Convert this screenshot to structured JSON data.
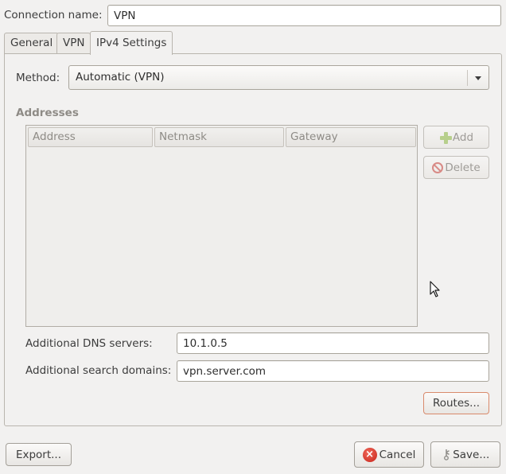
{
  "connection": {
    "label": "Connection name:",
    "value": "VPN"
  },
  "tabs": [
    {
      "label": "General"
    },
    {
      "label": "VPN"
    },
    {
      "label": "IPv4 Settings"
    }
  ],
  "active_tab": "IPv4 Settings",
  "method": {
    "label": "Method:",
    "value": "Automatic (VPN)"
  },
  "addresses": {
    "heading": "Addresses",
    "columns": [
      "Address",
      "Netmask",
      "Gateway"
    ],
    "rows": [],
    "add_label": "Add",
    "delete_label": "Delete"
  },
  "dns": {
    "label": "Additional DNS servers:",
    "value": "10.1.0.5"
  },
  "search_domains": {
    "label": "Additional search domains:",
    "value": "vpn.server.com"
  },
  "routes_label": "Routes...",
  "footer": {
    "export_label": "Export...",
    "cancel_label": "Cancel",
    "save_label": "Save..."
  },
  "colors": {
    "window_bg": "#f2f1f0",
    "disabled_text": "#8e8b86",
    "focus_border": "#d98a6c",
    "cancel_icon": "#c7241a",
    "add_icon": "#b7cf8c",
    "delete_icon": "#d88a86"
  },
  "icons": [
    "plus-icon",
    "no-sign-icon",
    "cancel-icon",
    "keys-icon",
    "chevron-down-icon",
    "mouse-pointer-icon"
  ]
}
